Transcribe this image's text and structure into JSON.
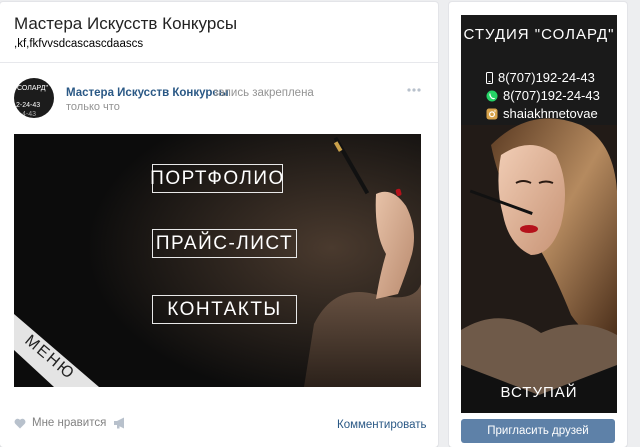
{
  "page": {
    "title": "Мастера Искусств Конкурсы",
    "status": ",kf,fkfvvsdcascascdaascs"
  },
  "post": {
    "avatar_line1": "СОЛАРД\"",
    "avatar_line2": "2-24-43",
    "avatar_line3": "4-43",
    "author": "Мастера Искусств Конкурсы",
    "action": "запись закреплена",
    "time": "только что",
    "banner": {
      "buttons": [
        "ПОРТФОЛИО",
        "ПРАЙС-ЛИСТ",
        "КОНТАКТЫ"
      ],
      "ribbon": "МЕНЮ"
    },
    "like_label": "Мне нравится",
    "comment_label": "Комментировать"
  },
  "sidebar": {
    "title": "СТУДИЯ \"СОЛАРД\"",
    "phone1": "8(707)192-24-43",
    "phone2": "8(707)192-24-43",
    "instagram": "shaiakhmetovae",
    "join": "ВСТУПАЙ",
    "invite": "Пригласить друзей"
  },
  "colors": {
    "accent": "#5e81a8",
    "link": "#2a5885",
    "muted": "#939393",
    "background": "#edeef0"
  }
}
